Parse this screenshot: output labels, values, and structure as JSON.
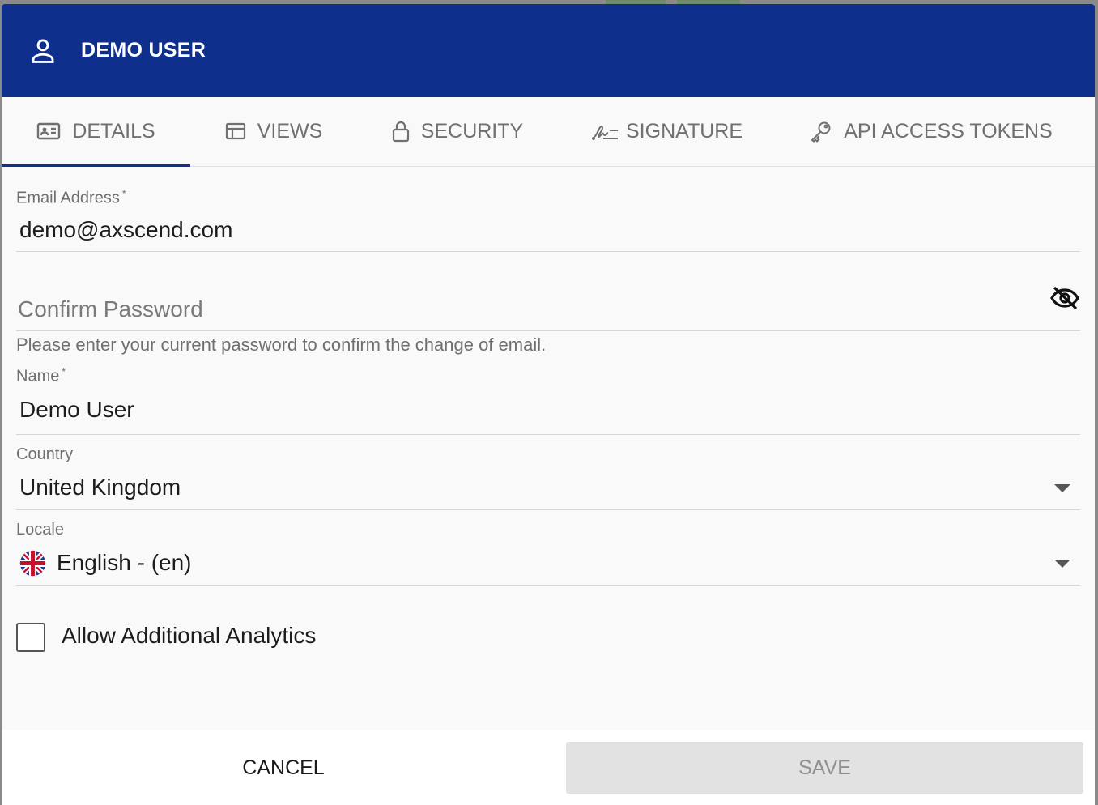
{
  "header": {
    "title": "DEMO USER",
    "icon": "user-icon"
  },
  "tabs": [
    {
      "label": "DETAILS",
      "icon": "id-card-icon",
      "active": true
    },
    {
      "label": "VIEWS",
      "icon": "layout-icon",
      "active": false
    },
    {
      "label": "SECURITY",
      "icon": "lock-icon",
      "active": false
    },
    {
      "label": "SIGNATURE",
      "icon": "signature-icon",
      "active": false
    },
    {
      "label": "API ACCESS TOKENS",
      "icon": "key-icon",
      "active": false
    }
  ],
  "form": {
    "email": {
      "label": "Email Address",
      "required": "*",
      "value": "demo@axscend.com"
    },
    "confirm_password": {
      "placeholder": "Confirm Password",
      "helper": "Please enter your current password to confirm the change of email.",
      "toggle_icon": "eye-off-icon"
    },
    "name": {
      "label": "Name",
      "required": "*",
      "value": "Demo User"
    },
    "country": {
      "label": "Country",
      "value": "United Kingdom"
    },
    "locale": {
      "label": "Locale",
      "value": "English - (en)",
      "flag": "uk-flag-icon"
    },
    "analytics": {
      "label": "Allow Additional Analytics",
      "checked": false
    }
  },
  "footer": {
    "cancel_label": "CANCEL",
    "save_label": "SAVE"
  },
  "colors": {
    "header_bg": "#0f2f8c",
    "active_tab_indicator": "#0f2f8c"
  }
}
